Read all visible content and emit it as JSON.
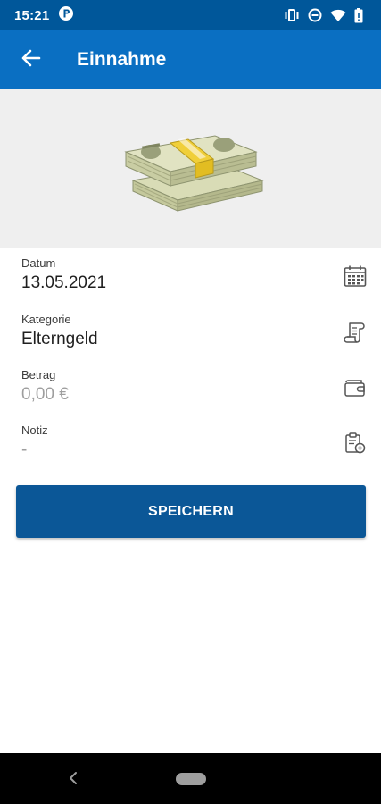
{
  "status_bar": {
    "time": "15:21",
    "icons": [
      "app-notification-icon",
      "vibrate-icon",
      "do-not-disturb-icon",
      "wifi-icon",
      "battery-icon"
    ]
  },
  "app_bar": {
    "title": "Einnahme",
    "back_icon": "arrow-back-icon"
  },
  "hero": {
    "image": "money-stack-illustration"
  },
  "form": {
    "date": {
      "label": "Datum",
      "value": "13.05.2021",
      "icon": "calendar-icon"
    },
    "category": {
      "label": "Kategorie",
      "value": "Elterngeld",
      "icon": "receipt-icon"
    },
    "amount": {
      "label": "Betrag",
      "value": "0,00 €",
      "icon": "wallet-icon"
    },
    "note": {
      "label": "Notiz",
      "value": "-",
      "icon": "clipboard-icon"
    }
  },
  "save_button": {
    "label": "SPEICHERN"
  },
  "nav": {
    "icons": [
      "back-icon",
      "home-pill-icon"
    ]
  },
  "colors": {
    "status_bar": "#00579a",
    "app_bar": "#0a6fc2",
    "button": "#0b5797",
    "hero_bg": "#efefef"
  }
}
